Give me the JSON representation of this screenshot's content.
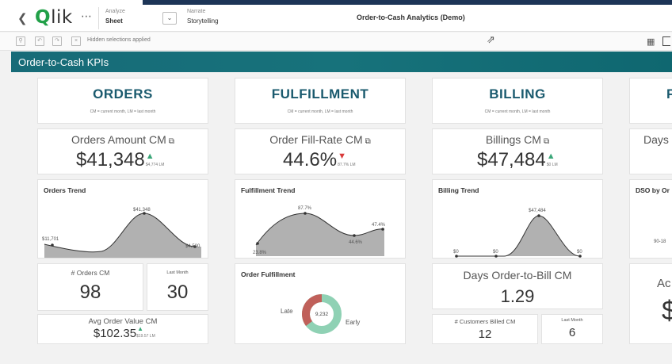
{
  "nav": {
    "logo": "Qlik",
    "analyze_label": "Analyze",
    "analyze_value": "Sheet",
    "narrate_label": "Narrate",
    "narrate_value": "Storytelling",
    "app_title": "Order-to-Cash Analytics (Demo)"
  },
  "toolbar": {
    "selections_text": "Hidden selections applied"
  },
  "sheet": {
    "title": "Order-to-Cash KPIs"
  },
  "orders": {
    "title": "ORDERS",
    "subtitle": "CM = current month, LM = last month",
    "kpi_label": "Orders Amount CM",
    "kpi_value": "$41,348",
    "kpi_lm": "$4,774 LM",
    "trend_title": "Orders Trend",
    "trend_labels": [
      "$11,701",
      "$41,348",
      "$4,500"
    ],
    "count_label": "# Orders CM",
    "count_value": "98",
    "last_month_label": "Last Month",
    "last_month_value": "30",
    "avg_label": "Avg Order Value CM",
    "avg_value": "$102.35",
    "avg_lm": "$19.57 LM"
  },
  "fulfillment": {
    "title": "FULFILLMENT",
    "subtitle": "CM = current month, LM = last month",
    "kpi_label": "Order Fill-Rate CM",
    "kpi_value": "44.6%",
    "kpi_lm": "87.7% LM",
    "trend_title": "Fulfillment Trend",
    "trend_labels": [
      "23.8%",
      "87.7%",
      "44.6%",
      "47.4%"
    ],
    "donut_title": "Order Fulfillment",
    "donut_center": "9,232",
    "late_label": "Late",
    "early_label": "Early"
  },
  "billing": {
    "title": "BILLING",
    "subtitle": "CM = current month, LM = last month",
    "kpi_label": "Billings CM",
    "kpi_value": "$47,484",
    "kpi_lm": "$0 LM",
    "trend_title": "Billing Trend",
    "trend_labels": [
      "$0",
      "$0",
      "$47,484",
      "$0"
    ],
    "days_label": "Days Order-to-Bill CM",
    "days_value": "1.29",
    "customers_label": "# Customers Billed CM",
    "customers_value": "12",
    "last_month_label": "Last Month",
    "last_month_value": "6"
  },
  "fourth": {
    "title_partial": "F",
    "kpi_partial": "Days",
    "trend_partial": "DSO by Or",
    "axis_partial": "90-18",
    "lower_partial": "Ac",
    "value_partial": "$"
  },
  "colors": {
    "accent": "#1a5a6e",
    "header_bg": "#176b78",
    "up": "#3aa678",
    "down": "#d93a3a",
    "early": "#8fd1b4",
    "late": "#c0605a"
  }
}
